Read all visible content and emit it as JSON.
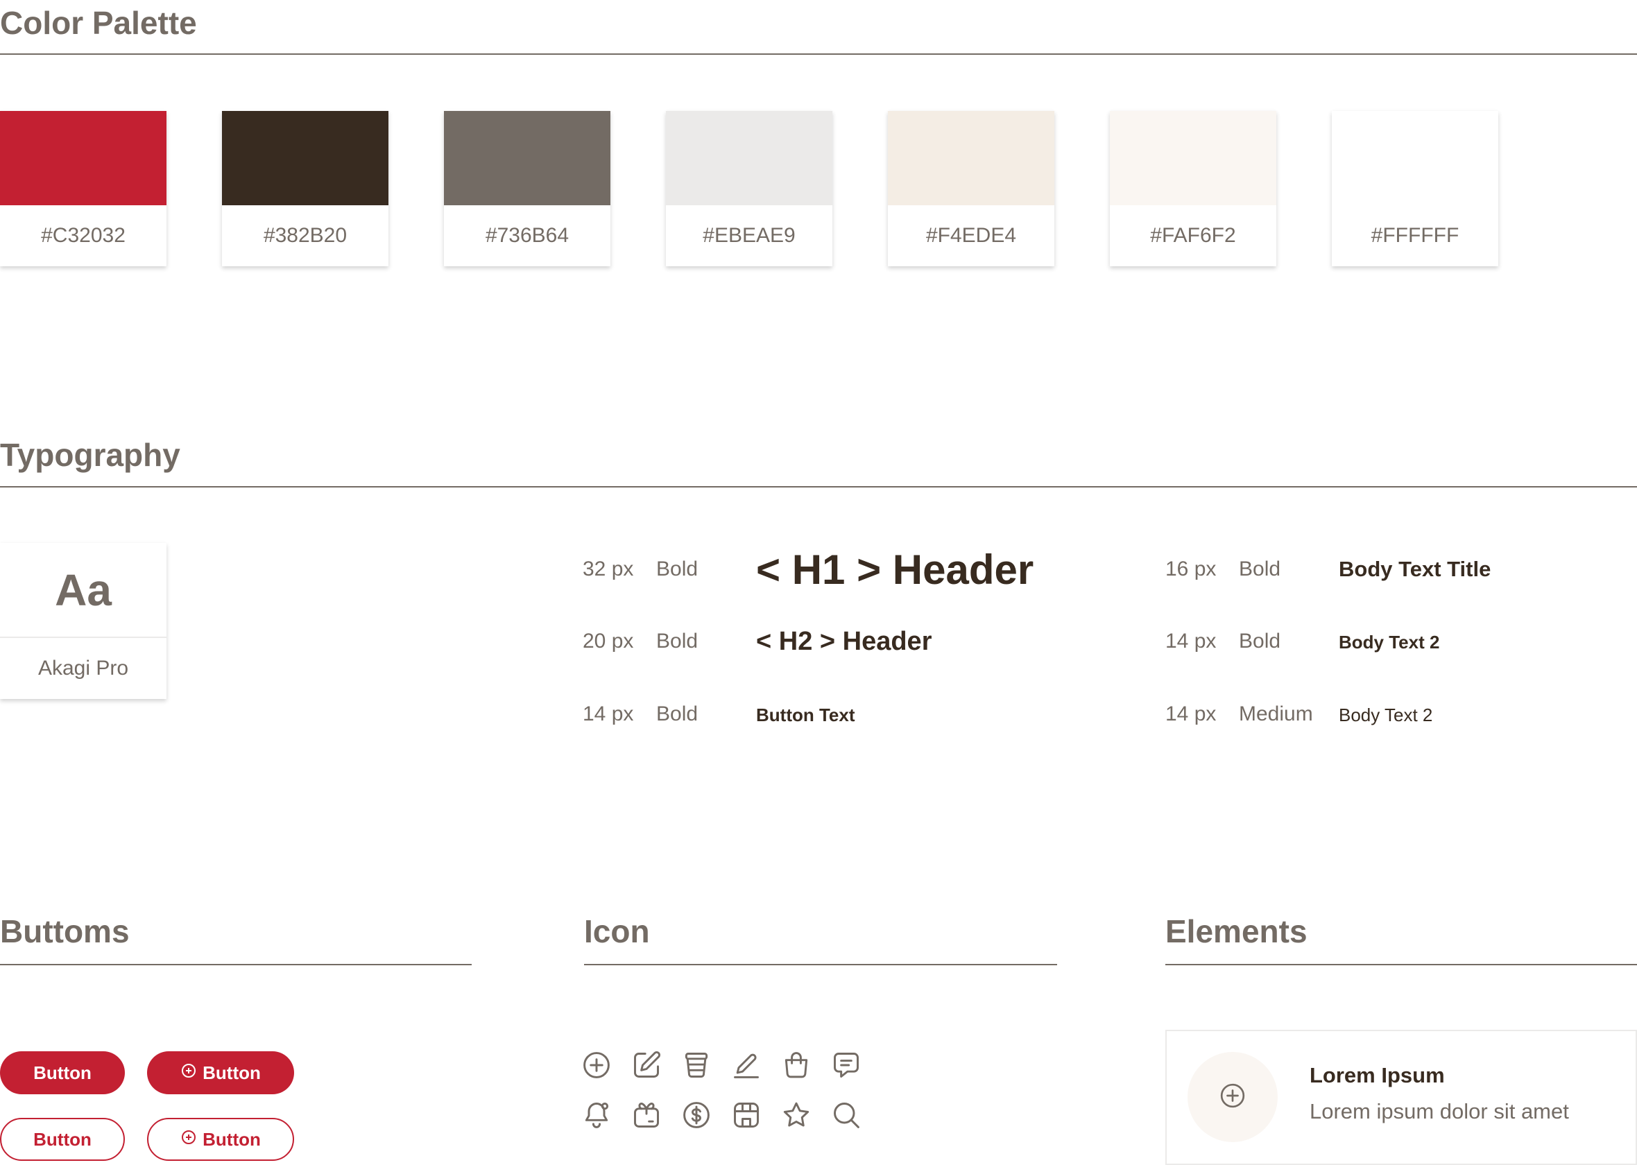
{
  "color_palette": {
    "title": "Color Palette",
    "swatches": [
      {
        "hex": "#C32032",
        "label": "#C32032"
      },
      {
        "hex": "#382B20",
        "label": "#382B20"
      },
      {
        "hex": "#736B64",
        "label": "#736B64"
      },
      {
        "hex": "#EBEAE9",
        "label": "#EBEAE9"
      },
      {
        "hex": "#F4EDE4",
        "label": "#F4EDE4"
      },
      {
        "hex": "#FAF6F2",
        "label": "#FAF6F2"
      },
      {
        "hex": "#FFFFFF",
        "label": "#FFFFFF"
      }
    ]
  },
  "typography": {
    "title": "Typography",
    "font_card": {
      "sample": "Aa",
      "name": "Akagi Pro"
    },
    "styles": [
      {
        "size": "32 px",
        "weight": "Bold",
        "sample": "< H1 > Header"
      },
      {
        "size": "20 px",
        "weight": "Bold",
        "sample": "< H2 > Header"
      },
      {
        "size": "14 px",
        "weight": "Bold",
        "sample": "Button Text"
      },
      {
        "size": "16 px",
        "weight": "Bold",
        "sample": "Body Text Title"
      },
      {
        "size": "14 px",
        "weight": "Bold",
        "sample": "Body Text 2"
      },
      {
        "size": "14 px",
        "weight": "Medium",
        "sample": "Body Text 2"
      }
    ]
  },
  "buttons": {
    "title": "Buttoms",
    "items": [
      {
        "label": "Button",
        "variant": "filled",
        "icon": ""
      },
      {
        "label": "Button",
        "variant": "filled",
        "icon": "plus-circle-icon"
      },
      {
        "label": "Button",
        "variant": "outline",
        "icon": ""
      },
      {
        "label": "Button",
        "variant": "outline",
        "icon": "plus-circle-icon"
      }
    ]
  },
  "icons": {
    "title": "Icon",
    "items": [
      "plus-circle-icon",
      "edit-icon",
      "cup-icon",
      "pen-icon",
      "shopping-bag-icon",
      "chat-icon",
      "bell-icon",
      "gift-icon",
      "dollar-icon",
      "store-icon",
      "star-icon",
      "search-icon"
    ]
  },
  "elements": {
    "title": "Elements",
    "card": {
      "title": "Lorem Ipsum",
      "subtitle": "Lorem ipsum dolor sit amet",
      "icon": "plus-circle-icon"
    }
  },
  "colors": {
    "primary": "#C32032",
    "text_dark": "#382B20",
    "text_muted": "#736B64",
    "border": "#EBEAE9"
  }
}
